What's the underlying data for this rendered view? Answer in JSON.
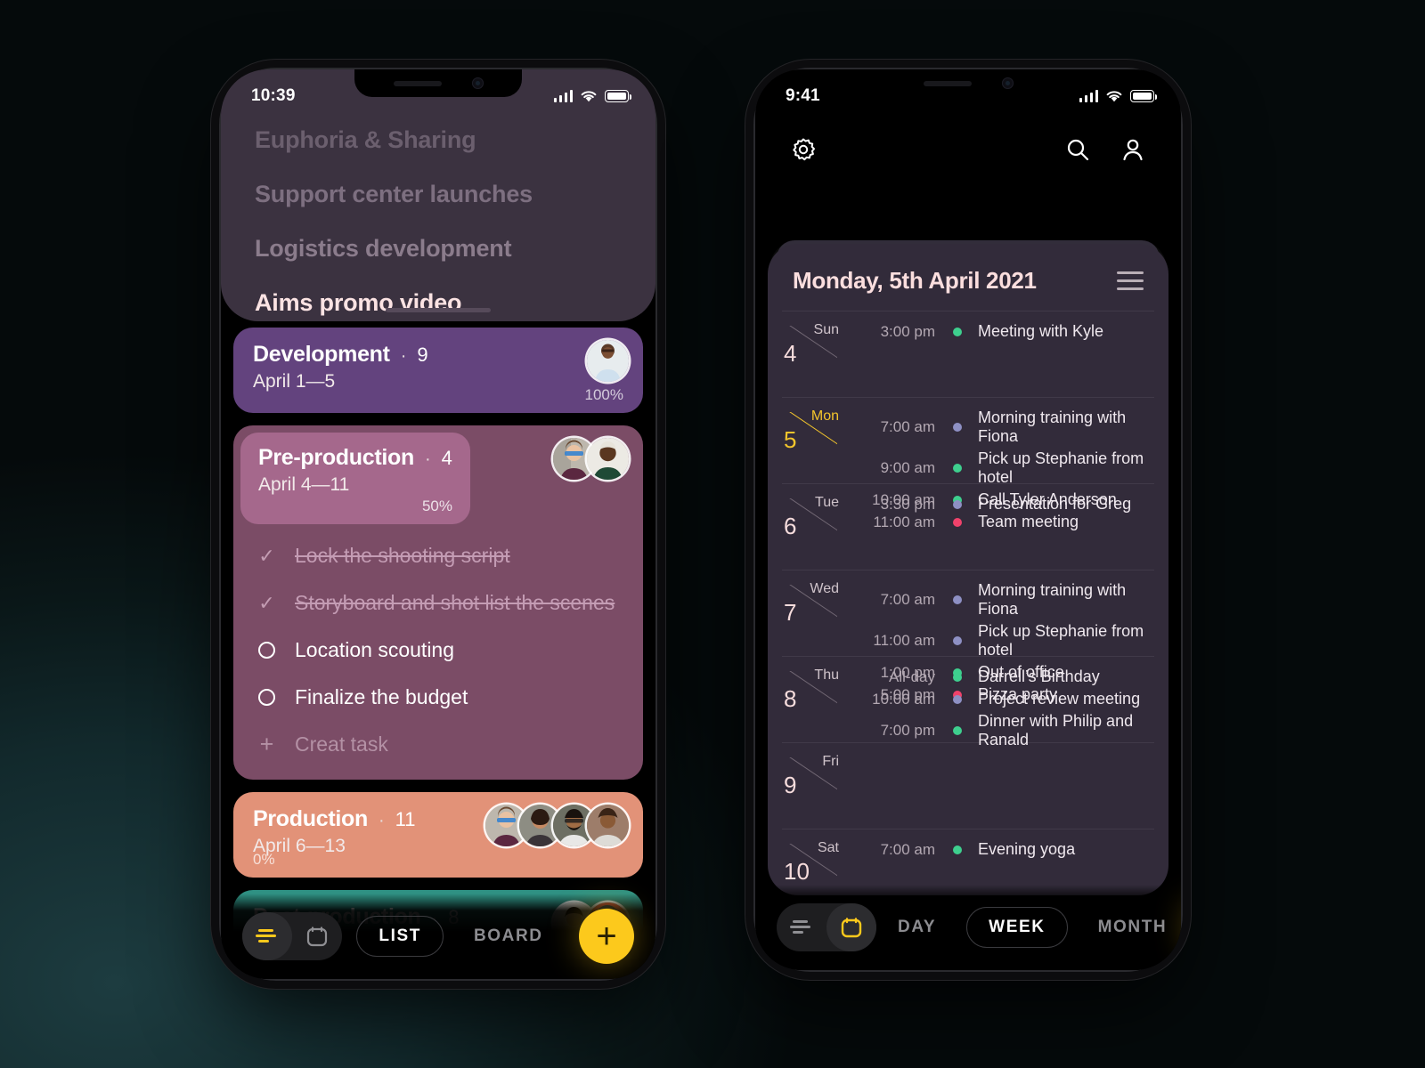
{
  "theme": {
    "accent_yellow": "#fcc91c",
    "background": "#0a1718",
    "card_development": "#63437e",
    "card_preproduction": "#7b4c66",
    "card_preproduction_head": "#a5688c",
    "card_production": "#e29278",
    "card_postproduction": "#2f9183",
    "calendar_card": "#322b3a",
    "dot_blue": "#8e90c4",
    "dot_green": "#3ecf8e",
    "dot_pink": "#f0426b",
    "today_yellow": "#f3c52c"
  },
  "left_phone": {
    "status_bar": {
      "time": "10:39",
      "signal_icon": "cellular-bars-icon",
      "wifi_icon": "wifi-icon",
      "battery_icon": "battery-icon"
    },
    "project_sheet": {
      "items": [
        {
          "label": "Euphoria & Sharing",
          "state": "dim"
        },
        {
          "label": "Support center launches",
          "state": "dim"
        },
        {
          "label": "Logistics development",
          "state": "dim"
        },
        {
          "label": "Aims promo video",
          "state": "active"
        }
      ]
    },
    "cards": [
      {
        "id": "development",
        "title": "Development",
        "separator": "·",
        "count": "9",
        "dates": "April 1—5",
        "percent": "100%",
        "avatars": 1
      },
      {
        "id": "preproduction",
        "title": "Pre-production",
        "separator": "·",
        "count": "4",
        "dates": "April 4—11",
        "percent": "50%",
        "avatars": 2,
        "tasks": [
          {
            "label": "Lock the shooting script",
            "state": "done"
          },
          {
            "label": "Storyboard and shot list the scenes",
            "state": "done"
          },
          {
            "label": "Location scouting",
            "state": "open"
          },
          {
            "label": "Finalize the budget",
            "state": "open"
          },
          {
            "label": "Creat task",
            "state": "add"
          }
        ]
      },
      {
        "id": "production",
        "title": "Production",
        "separator": "·",
        "count": "11",
        "dates": "April 6—13",
        "percent": "0%",
        "avatars": 4
      },
      {
        "id": "postproduction",
        "title": "Post-production",
        "separator": "·",
        "count": "8",
        "dates": "",
        "percent": "",
        "avatars": 2
      }
    ],
    "bottom_bar": {
      "mode_list_icon": "list-lines-icon",
      "mode_calendar_icon": "calendar-icon",
      "tabs": [
        {
          "label": "LIST",
          "selected": true
        },
        {
          "label": "BOARD",
          "selected": false
        }
      ],
      "fab_icon": "plus-icon",
      "fab_label": "+"
    }
  },
  "right_phone": {
    "status_bar": {
      "time": "9:41",
      "signal_icon": "cellular-bars-icon",
      "wifi_icon": "wifi-icon",
      "battery_icon": "battery-icon"
    },
    "top_bar": {
      "settings_icon": "gear-icon",
      "search_icon": "search-icon",
      "profile_icon": "person-icon"
    },
    "calendar": {
      "title": "Monday, 5th April 2021",
      "menu_icon": "hamburger-menu-icon",
      "days": [
        {
          "dow": "Sun",
          "num": "4",
          "today": false,
          "events": [
            {
              "time": "3:00 pm",
              "color": "green",
              "name": "Meeting with Kyle"
            }
          ]
        },
        {
          "dow": "Mon",
          "num": "5",
          "today": true,
          "events": [
            {
              "time": "7:00 am",
              "color": "blue",
              "name": "Morning training with Fiona"
            },
            {
              "time": "9:00 am",
              "color": "green",
              "name": "Pick up Stephanie from hotel"
            },
            {
              "time": "10:00 am",
              "color": "green",
              "name": "Call Tyler Anderson"
            },
            {
              "time": "11:00 am",
              "color": "pink",
              "name": "Team meeting"
            }
          ]
        },
        {
          "dow": "Tue",
          "num": "6",
          "today": false,
          "events": [
            {
              "time": "3:30 pm",
              "color": "blue",
              "name": "Presentation for Greg"
            }
          ]
        },
        {
          "dow": "Wed",
          "num": "7",
          "today": false,
          "events": [
            {
              "time": "7:00 am",
              "color": "blue",
              "name": "Morning training with Fiona"
            },
            {
              "time": "11:00 am",
              "color": "blue",
              "name": "Pick up Stephanie from hotel"
            },
            {
              "time": "1:00 pm",
              "color": "green",
              "name": "Out of office"
            },
            {
              "time": "5:00 pm",
              "color": "pink",
              "name": "Pizza party"
            }
          ]
        },
        {
          "dow": "Thu",
          "num": "8",
          "today": false,
          "events": [
            {
              "time": "All-day",
              "color": "green",
              "name": "Darrell’s Birthday"
            },
            {
              "time": "10:00 am",
              "color": "blue",
              "name": "Project review meeting"
            },
            {
              "time": "7:00 pm",
              "color": "green",
              "name": "Dinner with Philip and Ranald"
            }
          ]
        },
        {
          "dow": "Fri",
          "num": "9",
          "today": false,
          "events": []
        },
        {
          "dow": "Sat",
          "num": "10",
          "today": false,
          "events": [
            {
              "time": "7:00 am",
              "color": "green",
              "name": "Evening yoga"
            }
          ]
        }
      ]
    },
    "bottom_bar": {
      "mode_list_icon": "list-lines-icon",
      "mode_calendar_icon": "calendar-icon",
      "tabs": [
        {
          "label": "DAY",
          "selected": false
        },
        {
          "label": "WEEK",
          "selected": true
        },
        {
          "label": "MONTH",
          "selected": false
        }
      ],
      "fab_icon": "plus-icon",
      "fab_label": "+"
    }
  }
}
